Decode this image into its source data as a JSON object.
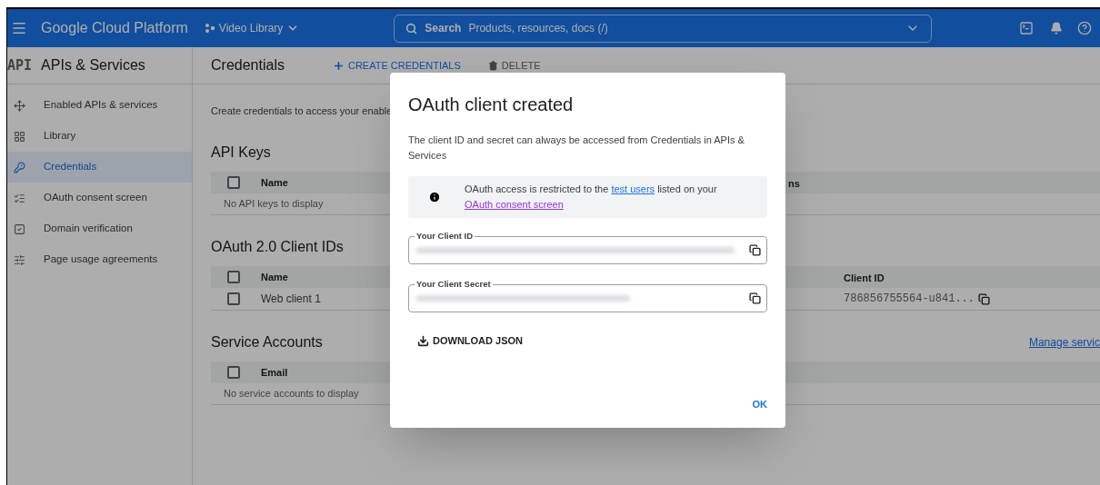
{
  "header": {
    "title": "Google Cloud Platform",
    "project": "Video Library",
    "search": {
      "label": "Search",
      "placeholder": "Products, resources, docs (/)"
    }
  },
  "section": {
    "logo": "API",
    "title": "APIs & Services"
  },
  "page": {
    "title": "Credentials",
    "actions": [
      {
        "label": "CREATE CREDENTIALS",
        "kind": "create"
      },
      {
        "label": "DELETE",
        "kind": "delete"
      }
    ]
  },
  "sidebar": {
    "items": [
      {
        "label": "Enabled APIs & services",
        "kind": "apis",
        "selected": false
      },
      {
        "label": "Library",
        "kind": "library",
        "selected": false
      },
      {
        "label": "Credentials",
        "kind": "credentials",
        "selected": true
      },
      {
        "label": "OAuth consent screen",
        "kind": "consent",
        "selected": false
      },
      {
        "label": "Domain verification",
        "kind": "domain",
        "selected": false
      },
      {
        "label": "Page usage agreements",
        "kind": "agreements",
        "selected": false
      }
    ]
  },
  "main": {
    "intro": "Create credentials to access your enable",
    "sections": [
      {
        "title": "API Keys",
        "all_checked": false,
        "columns": [
          "Name",
          "ns"
        ],
        "empty": "No API keys to display"
      },
      {
        "title": "OAuth 2.0 Client IDs",
        "all_checked": false,
        "columns": [
          "Name",
          "Client ID"
        ],
        "rows": [
          {
            "name": "Web client 1",
            "client_id": "786856755564-u841...",
            "checked": false
          }
        ]
      },
      {
        "title": "Service Accounts",
        "link": "Manage servic",
        "all_checked": false,
        "columns": [
          "Email"
        ],
        "empty": "No service accounts to display"
      }
    ]
  },
  "dialog": {
    "title": "OAuth client created",
    "description": "The client ID and secret can always be accessed from Credentials in APIs & Services",
    "notice": [
      {
        "kind": "text",
        "text": "OAuth access is restricted to the"
      },
      {
        "kind": "link",
        "text": "test users",
        "visited": false
      },
      {
        "kind": "text",
        "text": "listed on your"
      },
      {
        "kind": "link",
        "text": "OAuth consent screen",
        "visited": true
      }
    ],
    "fields": [
      {
        "label": "Your Client ID"
      },
      {
        "label": "Your Client Secret"
      }
    ],
    "download": "DOWNLOAD JSON",
    "ok": "OK"
  }
}
